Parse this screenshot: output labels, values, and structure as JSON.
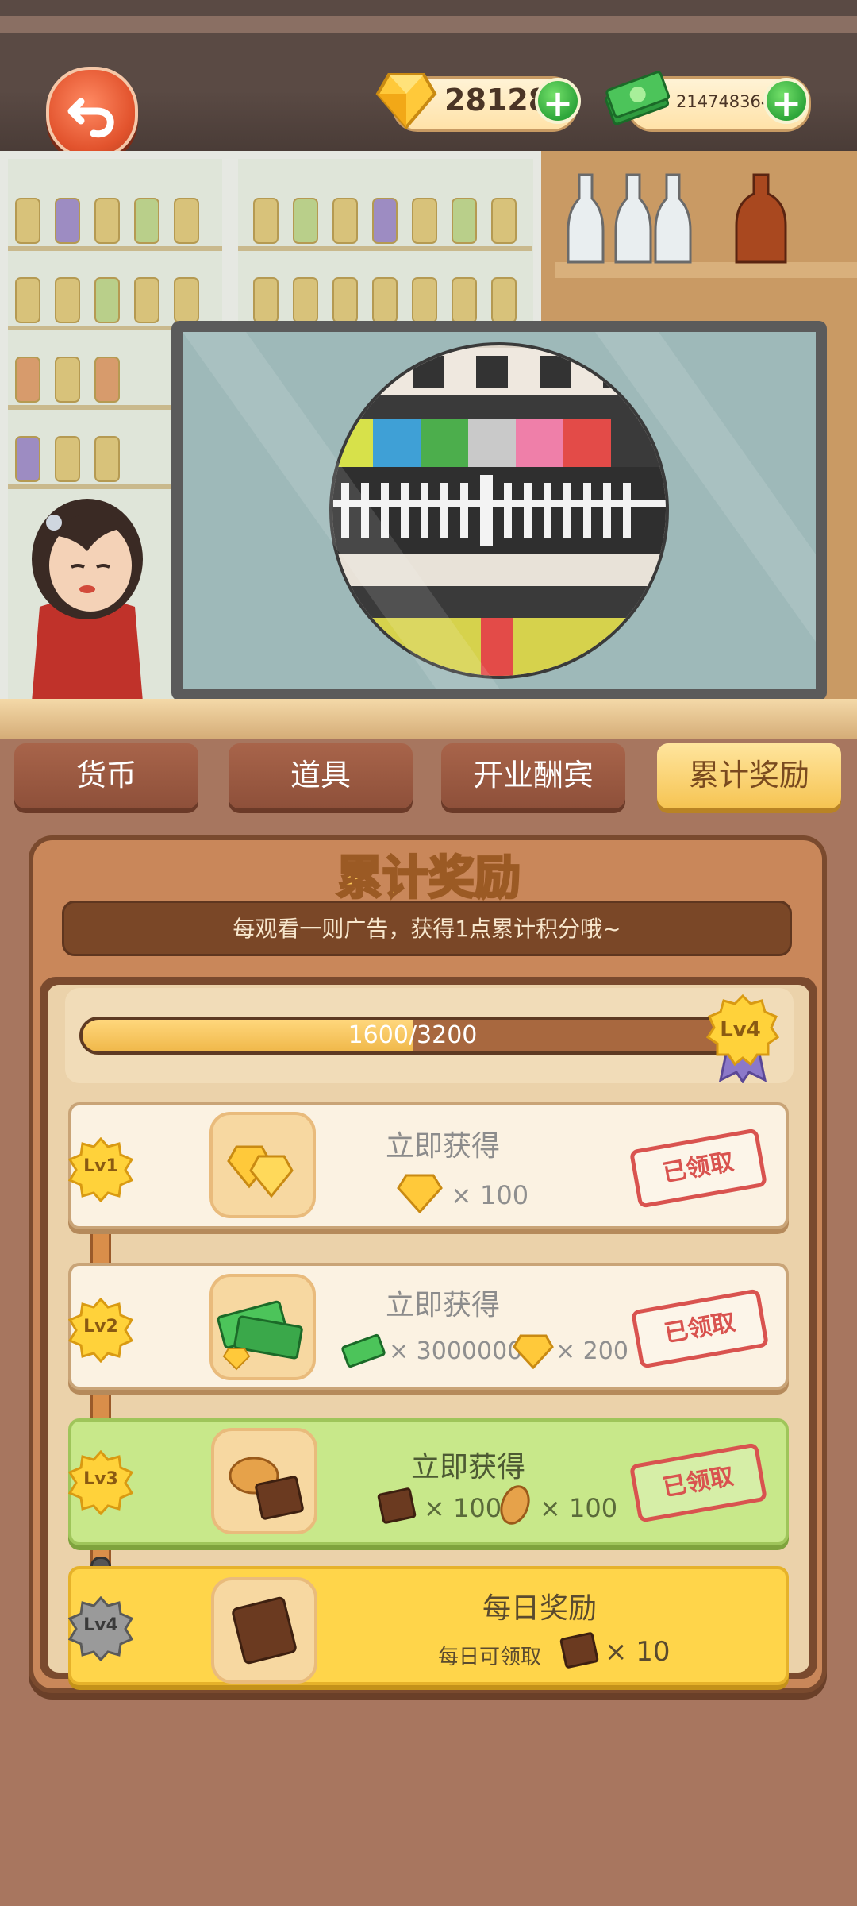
{
  "header": {
    "gems": "28128",
    "cash": "2147483647"
  },
  "tabs": [
    {
      "label": "货币",
      "active": false
    },
    {
      "label": "道具",
      "active": false
    },
    {
      "label": "开业酬宾",
      "active": false
    },
    {
      "label": "累计奖励",
      "active": true
    }
  ],
  "panel": {
    "title": "累计奖励",
    "hint": "每观看一则广告，获得1点累计积分哦~",
    "progress": {
      "current": 1600,
      "total": 3200,
      "text": "1600/3200",
      "badge": "Lv4"
    }
  },
  "rewards": [
    {
      "level": "Lv1",
      "title": "立即获得",
      "q1": "× 100",
      "status": "已领取"
    },
    {
      "level": "Lv2",
      "title": "立即获得",
      "q1": "× 3000000",
      "q2": "× 200",
      "status": "已领取"
    },
    {
      "level": "Lv3",
      "title": "立即获得",
      "q1": "× 100",
      "q2": "× 100",
      "status": "已领取"
    },
    {
      "level": "Lv4",
      "title": "每日奖励",
      "prefix": "每日可领取",
      "q1": "× 10"
    }
  ],
  "colors": {
    "accent": "#f6c452",
    "stamp": "#d9534f",
    "green_row": "#c8e88a",
    "yellow_row": "#ffd54a"
  }
}
